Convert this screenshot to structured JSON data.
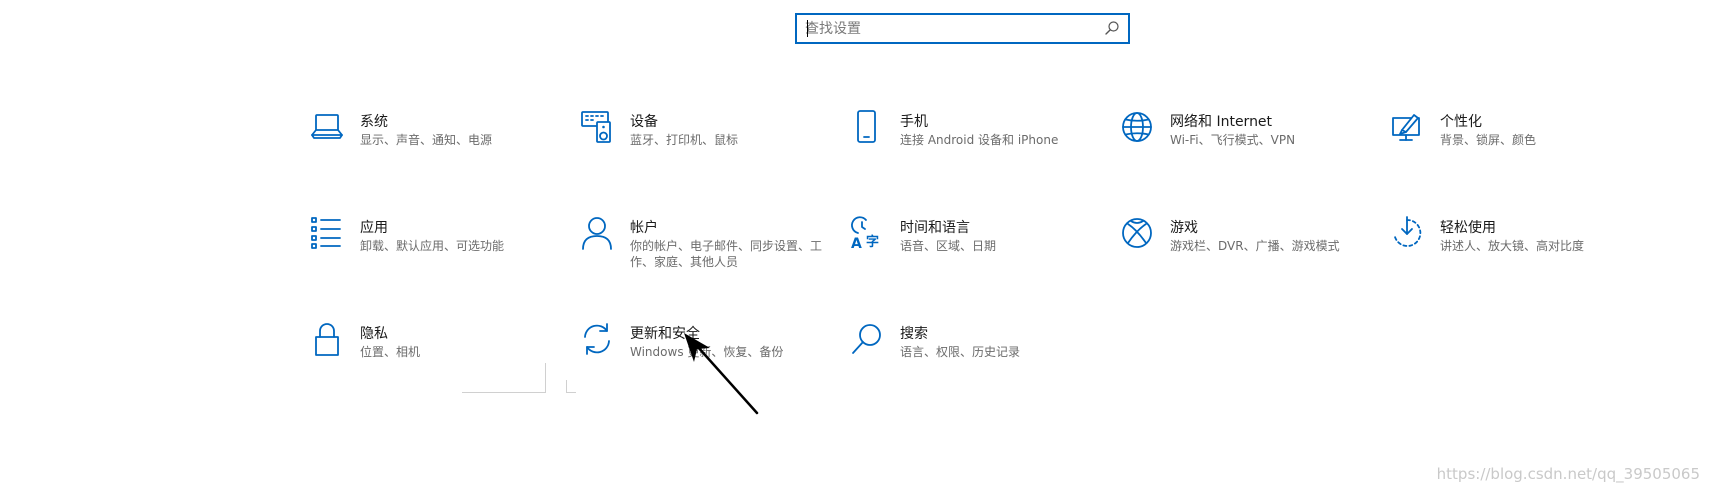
{
  "search": {
    "placeholder": "查找设置"
  },
  "tiles": [
    {
      "title": "系统",
      "desc": "显示、声音、通知、电源",
      "icon": "laptop-icon"
    },
    {
      "title": "设备",
      "desc": "蓝牙、打印机、鼠标",
      "icon": "devices-icon"
    },
    {
      "title": "手机",
      "desc": "连接 Android 设备和 iPhone",
      "icon": "phone-icon"
    },
    {
      "title": "网络和 Internet",
      "desc": "Wi-Fi、飞行模式、VPN",
      "icon": "globe-icon"
    },
    {
      "title": "个性化",
      "desc": "背景、锁屏、颜色",
      "icon": "personalize-icon"
    },
    {
      "title": "应用",
      "desc": "卸载、默认应用、可选功能",
      "icon": "apps-list-icon"
    },
    {
      "title": "帐户",
      "desc": "你的帐户、电子邮件、同步设置、工作、家庭、其他人员",
      "icon": "person-icon"
    },
    {
      "title": "时间和语言",
      "desc": "语音、区域、日期",
      "icon": "time-language-icon"
    },
    {
      "title": "游戏",
      "desc": "游戏栏、DVR、广播、游戏模式",
      "icon": "xbox-icon"
    },
    {
      "title": "轻松使用",
      "desc": "讲述人、放大镜、高对比度",
      "icon": "ease-of-access-icon"
    },
    {
      "title": "隐私",
      "desc": "位置、相机",
      "icon": "lock-icon"
    },
    {
      "title": "更新和安全",
      "desc": "Windows 更新、恢复、备份",
      "icon": "sync-icon"
    },
    {
      "title": "搜索",
      "desc": "语言、权限、历史记录",
      "icon": "search-icon"
    }
  ],
  "watermark": "https://blog.csdn.net/qq_39505065",
  "accent_color": "#0067c0"
}
